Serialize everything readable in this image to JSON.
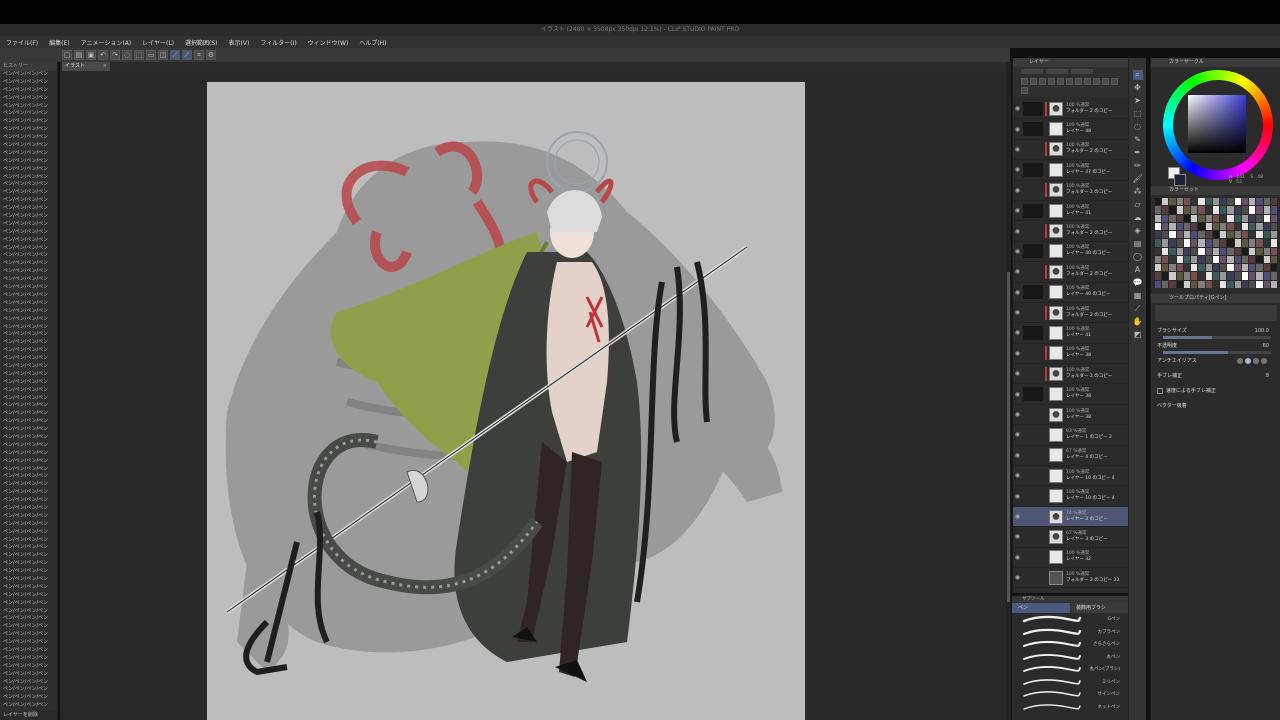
{
  "app": {
    "title": "イラスト (2480 × 3508px 350dpi 12.1%) - CLIP STUDIO PAINT PRO"
  },
  "menu": [
    "ファイル(F)",
    "編集(E)",
    "アニメーション(A)",
    "レイヤー(L)",
    "選択範囲(S)",
    "表示(V)",
    "フィルター(I)",
    "ウィンドウ(W)",
    "ヘルプ(H)"
  ],
  "document_tab": {
    "label": "イラスト",
    "close": "×"
  },
  "left_panel": {
    "header": "ヒストリー",
    "item_label": "ペン/ペン/ペン/ペン",
    "footer": "レイヤーを削除"
  },
  "layer_panel": {
    "title": "レイヤー",
    "layers": [
      {
        "blend": "100 %通常",
        "name": "フォルダー 2 のコピー",
        "thumb": "dark",
        "mask": true,
        "red": true
      },
      {
        "blend": "100 %通常",
        "name": "レイヤー 48",
        "thumb": "light",
        "mask": true,
        "red": false
      },
      {
        "blend": "100 %通常",
        "name": "フォルダー 2 のコピー",
        "thumb": "dark",
        "mask": false,
        "red": true
      },
      {
        "blend": "100 %通常",
        "name": "レイヤー 47 のコピー",
        "thumb": "light",
        "mask": true,
        "red": false
      },
      {
        "blend": "100 %通常",
        "name": "フォルダー 2 のコピー",
        "thumb": "dark",
        "mask": false,
        "red": true
      },
      {
        "blend": "100 %通常",
        "name": "レイヤー 41",
        "thumb": "light",
        "mask": true,
        "red": false
      },
      {
        "blend": "100 %通常",
        "name": "フォルダー 2 のコピー",
        "thumb": "dark",
        "mask": false,
        "red": true
      },
      {
        "blend": "100 %通常",
        "name": "レイヤー 40 のコピー",
        "thumb": "light",
        "mask": true,
        "red": false
      },
      {
        "blend": "100 %通常",
        "name": "フォルダー 2 のコピー",
        "thumb": "dark",
        "mask": false,
        "red": true
      },
      {
        "blend": "100 %通常",
        "name": "レイヤー 40 のコピー",
        "thumb": "light",
        "mask": true,
        "red": false
      },
      {
        "blend": "100 %通常",
        "name": "フォルダー 2 のコピー",
        "thumb": "dark",
        "mask": false,
        "red": true
      },
      {
        "blend": "100 %通常",
        "name": "レイヤー 41",
        "thumb": "light",
        "mask": true,
        "red": false
      },
      {
        "blend": "100 %通常",
        "name": "レイヤー 38",
        "thumb": "light",
        "mask": false,
        "red": true
      },
      {
        "blend": "100 %通常",
        "name": "フォルダー 2 のコピー",
        "thumb": "dark",
        "mask": false,
        "red": true
      },
      {
        "blend": "100 %通常",
        "name": "レイヤー 38",
        "thumb": "light",
        "mask": true,
        "red": false
      },
      {
        "blend": "100 %通常",
        "name": "レイヤー 38",
        "thumb": "dark",
        "mask": false,
        "red": false
      },
      {
        "blend": "83 %通常",
        "name": "レイヤー 1 のコピー 2",
        "thumb": "light",
        "mask": false,
        "red": false
      },
      {
        "blend": "67 %通常",
        "name": "レイヤー 4 のコピー",
        "thumb": "light",
        "mask": false,
        "red": false
      },
      {
        "blend": "100 %通常",
        "name": "レイヤー 10 のコピー 4",
        "thumb": "light",
        "mask": false,
        "red": false
      },
      {
        "blend": "100 %通常",
        "name": "レイヤー 10 のコピー 4",
        "thumb": "light",
        "mask": false,
        "red": false
      },
      {
        "blend": "74 %通常",
        "name": "レイヤー 3 のコピー",
        "thumb": "dark",
        "mask": false,
        "red": false,
        "selected": true
      },
      {
        "blend": "67 %通常",
        "name": "レイヤー 3 のコピー",
        "thumb": "dark",
        "mask": false,
        "red": false
      },
      {
        "blend": "100 %通常",
        "name": "レイヤー 32",
        "thumb": "light",
        "mask": false,
        "red": false
      },
      {
        "blend": "100 %通常",
        "name": "フォルダー 2 のコピー 33",
        "thumb": "folder",
        "mask": false,
        "red": false
      }
    ]
  },
  "subtool_panel": {
    "header": "サブツール",
    "tabs": [
      "ペン",
      "装飾用ブラシ"
    ],
    "brushes": [
      "Gペン",
      "カブラペン",
      "さらさらペン",
      "丸ペン",
      "丸ペン(ブラシ)",
      "ミリペン",
      "サインペン",
      "ネットペン",
      "マーカーペン",
      "フェルトペン",
      "ブラシ"
    ]
  },
  "color_panel": {
    "title": "カラーサークル",
    "hsv": [
      "H",
      "S",
      "V"
    ],
    "hsv_values": [
      "241",
      "48",
      "53"
    ],
    "fg": "#f2f2f2",
    "bg": "#1b1f3b"
  },
  "palette_panel": {
    "title": "カラーセット"
  },
  "tool_property": {
    "title": "ツールプロパティ[Gペン]",
    "rows": [
      {
        "label": "ブラシサイズ",
        "value": "100.0",
        "fill": 0.45
      },
      {
        "label": "不透明度",
        "value": "60",
        "fill": 0.6
      },
      {
        "label": "アンチエイリアス",
        "value": ""
      },
      {
        "label": "手ブレ補正",
        "value": "8"
      },
      {
        "label": "速度による手ブレ補正",
        "value": ""
      },
      {
        "label": "ベクター吸着",
        "value": ""
      }
    ]
  }
}
